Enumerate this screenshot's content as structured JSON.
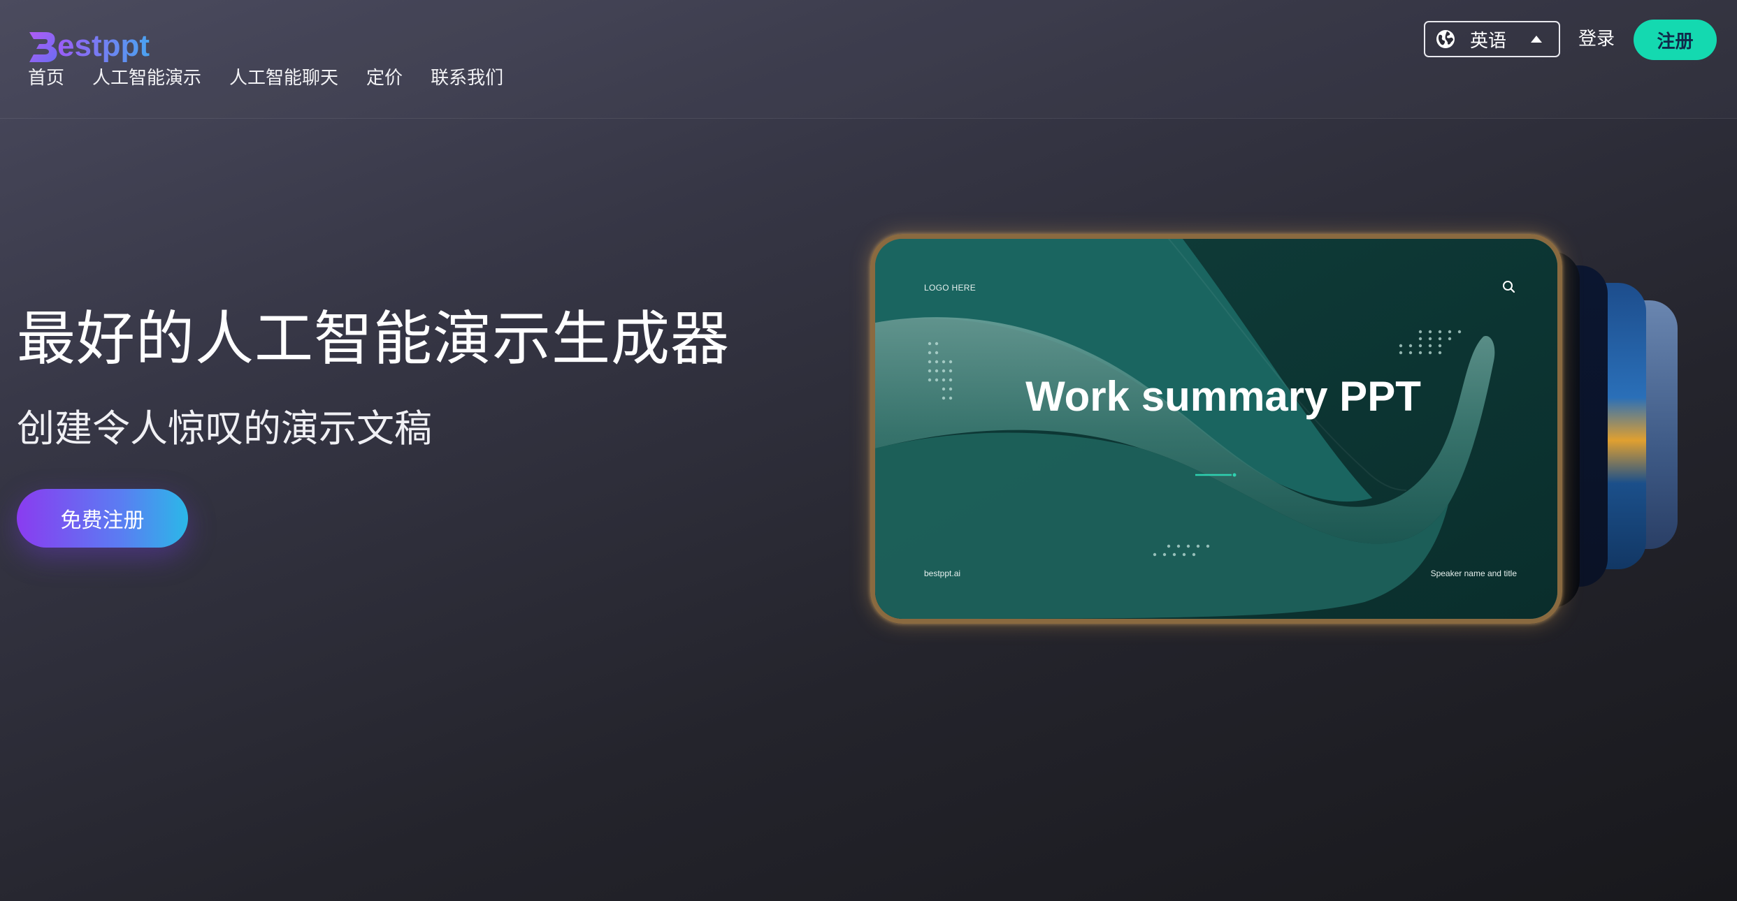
{
  "brand": {
    "name": "Bestppt",
    "logo_letter": "B",
    "logo_rest": "estppt",
    "colors": {
      "logo_gradient_start": "#9b5cf6",
      "logo_gradient_end": "#4aa3f0"
    }
  },
  "nav": {
    "items": [
      {
        "label": "首页"
      },
      {
        "label": "人工智能演示"
      },
      {
        "label": "人工智能聊天"
      },
      {
        "label": "定价"
      },
      {
        "label": "联系我们"
      }
    ]
  },
  "header_actions": {
    "language": {
      "icon": "globe-icon",
      "label": "英语",
      "caret": "caret-up-icon"
    },
    "login_label": "登录",
    "register_label": "注册",
    "register_color": "#14d9b0"
  },
  "hero": {
    "title": "最好的人工智能演示生成器",
    "subtitle": "创建令人惊叹的演示文稿",
    "cta_label": "免费注册"
  },
  "slide": {
    "logo_text": "LOGO HERE",
    "title": "Work summary PPT",
    "footer_left": "bestppt.ai",
    "footer_right": "Speaker name and title",
    "search_icon": "search-icon",
    "accent": "#2fd1b0"
  }
}
